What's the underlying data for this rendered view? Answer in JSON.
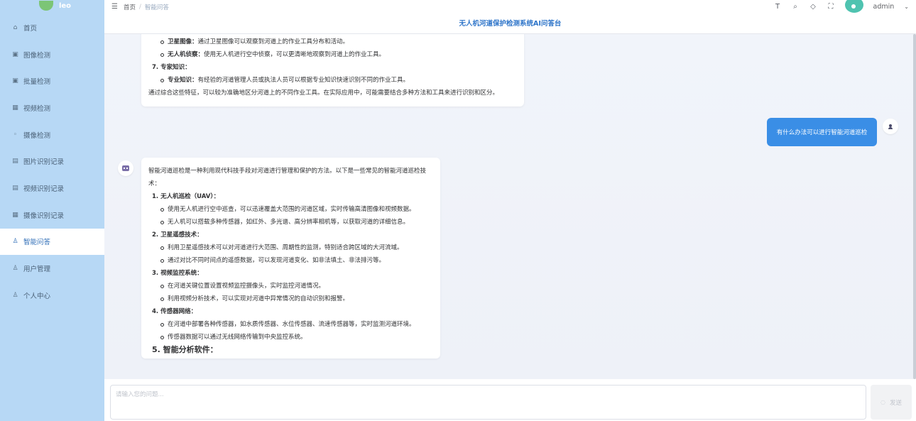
{
  "sidebar": {
    "logo_text": "leo",
    "items": [
      {
        "label": "首页",
        "icon": "home-icon"
      },
      {
        "label": "图像检测",
        "icon": "image-icon"
      },
      {
        "label": "批量检测",
        "icon": "images-icon"
      },
      {
        "label": "视频检测",
        "icon": "video-icon"
      },
      {
        "label": "摄像检测",
        "icon": "camera-icon"
      },
      {
        "label": "图片识别记录",
        "icon": "doc-icon"
      },
      {
        "label": "视频识别记录",
        "icon": "doc-icon"
      },
      {
        "label": "摄像识别记录",
        "icon": "table-icon"
      },
      {
        "label": "智能问答",
        "icon": "user-icon"
      },
      {
        "label": "用户管理",
        "icon": "user-icon"
      },
      {
        "label": "个人中心",
        "icon": "user-icon"
      }
    ],
    "active_index": 8
  },
  "topbar": {
    "breadcrumb": [
      "首页",
      "智能问答"
    ],
    "user_name": "admin"
  },
  "title": "无人机河道保护检测系统AI问答台",
  "messages": {
    "bot_prev": {
      "lines": [
        {
          "kind": "bullet",
          "bold": "卫星图像：",
          "text": "通过卫星图像可以观察到河道上的作业工具分布和活动。"
        },
        {
          "kind": "bullet",
          "bold": "无人机侦察：",
          "text": "使用无人机进行空中侦察，可以更清晰地观察到河道上的作业工具。"
        },
        {
          "kind": "num",
          "bold": "7. 专家知识：",
          "text": ""
        },
        {
          "kind": "bullet",
          "bold": "专业知识：",
          "text": "有经验的河道管理人员或执法人员可以根据专业知识快速识别不同的作业工具。"
        },
        {
          "kind": "plain",
          "bold": "",
          "text": "通过综合这些特征，可以较为准确地区分河道上的不同作业工具。在实际应用中，可能需要结合多种方法和工具来进行识别和区分。"
        }
      ]
    },
    "user": "有什么办法可以进行智能河道巡检",
    "bot_current": {
      "intro": "智能河道巡检是一种利用现代科技手段对河道进行管理和保护的方法。以下是一些常见的智能河道巡检技术：",
      "lines": [
        {
          "kind": "num",
          "bold": "1. 无人机巡检（UAV）：",
          "text": ""
        },
        {
          "kind": "bullet",
          "bold": "",
          "text": "使用无人机进行空中巡查，可以迅速覆盖大范围的河道区域，实时传输高清图像和视频数据。"
        },
        {
          "kind": "bullet",
          "bold": "",
          "text": "无人机可以搭载多种传感器，如红外、多光谱、高分辨率相机等，以获取河道的详细信息。"
        },
        {
          "kind": "num",
          "bold": "2. 卫星遥感技术：",
          "text": ""
        },
        {
          "kind": "bullet",
          "bold": "",
          "text": "利用卫星遥感技术可以对河道进行大范围、周期性的监测，特别适合跨区域的大河流域。"
        },
        {
          "kind": "bullet",
          "bold": "",
          "text": "通过对比不同时间点的遥感数据，可以发现河道变化、如非法填土、非法排污等。"
        },
        {
          "kind": "num",
          "bold": "3. 视频监控系统：",
          "text": ""
        },
        {
          "kind": "bullet",
          "bold": "",
          "text": "在河道关键位置设置视频监控摄像头，实时监控河道情况。"
        },
        {
          "kind": "bullet",
          "bold": "",
          "text": "利用视频分析技术，可以实现对河道中异常情况的自动识别和报警。"
        },
        {
          "kind": "num",
          "bold": "4. 传感器网络：",
          "text": ""
        },
        {
          "kind": "bullet",
          "bold": "",
          "text": "在河道中部署各种传感器，如水质传感器、水位传感器、流速传感器等，实时监测河道环境。"
        },
        {
          "kind": "bullet",
          "bold": "",
          "text": "传感器数据可以通过无线网络传输到中央监控系统。"
        }
      ],
      "last_heading": "5. 智能分析软件："
    }
  },
  "input": {
    "placeholder": "请输入您的问题...",
    "send_label": "发送"
  }
}
